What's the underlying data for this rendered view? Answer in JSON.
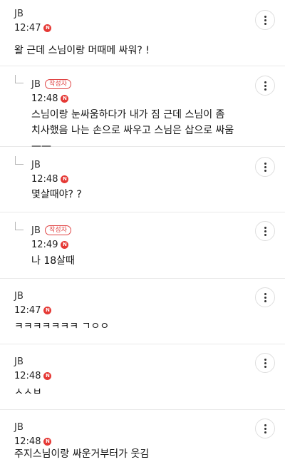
{
  "comments": [
    {
      "author": "JB",
      "time": "12:47",
      "new_badge": "N",
      "is_reply": false,
      "is_op": false,
      "text": "왈 근데 스님이랑 머때메 싸워? !"
    },
    {
      "author": "JB",
      "time": "12:48",
      "new_badge": "N",
      "is_reply": true,
      "is_op": true,
      "op_label": "작성자",
      "text": "스님이랑 눈싸움하다가 내가 짐 근데 스님이 좀\n치사했음 나는 손으로 싸우고 스님은 삽으로 싸움 ——"
    },
    {
      "author": "JB",
      "time": "12:48",
      "new_badge": "N",
      "is_reply": true,
      "is_op": false,
      "text": "몇살때야? ?"
    },
    {
      "author": "JB",
      "time": "12:49",
      "new_badge": "N",
      "is_reply": true,
      "is_op": true,
      "op_label": "작성자",
      "text": "나 18살때"
    },
    {
      "author": "JB",
      "time": "12:47",
      "new_badge": "N",
      "is_reply": false,
      "is_op": false,
      "text": "ㅋㅋㅋㅋㅋㅋㅋ ㄱㅇㅇ"
    },
    {
      "author": "JB",
      "time": "12:48",
      "new_badge": "N",
      "is_reply": false,
      "is_op": false,
      "text": "ㅅㅅㅂ"
    },
    {
      "author": "JB",
      "time": "12:48",
      "new_badge": "N",
      "is_reply": false,
      "is_op": false,
      "text": "주지스님이랑 싸운거부터가 웃김"
    }
  ],
  "icons": {
    "more": "more-vertical-icon",
    "reply": "reply-arrow-icon",
    "new": "new-badge-icon"
  },
  "colors": {
    "accent": "#e53935",
    "divider": "#e9e9e9"
  }
}
